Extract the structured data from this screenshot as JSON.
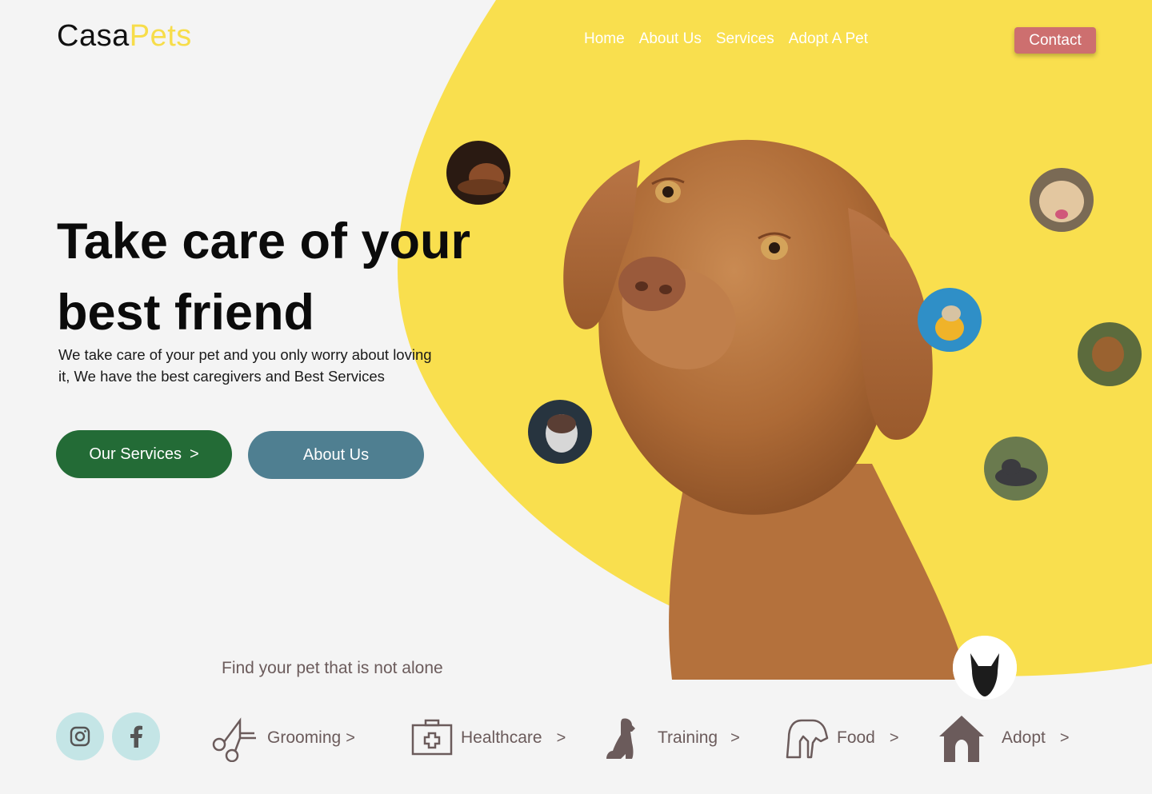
{
  "brand": {
    "part1": "Casa",
    "part2": "Pets"
  },
  "nav": {
    "items": [
      "Home",
      "About Us",
      "Services",
      "Adopt A Pet"
    ]
  },
  "contact_label": "Contact",
  "hero": {
    "title_line1": "Take care of your",
    "title_line2": "best friend",
    "description": "We take care of your pet and you only worry about loving it, We have the best caregivers and Best Services",
    "services_btn": "Our Services",
    "about_btn": "About Us",
    "chevron": ">"
  },
  "tagline": "Find your pet that is not alone",
  "categories": [
    {
      "label": "Grooming",
      "icon": "scissors-icon"
    },
    {
      "label": "Healthcare",
      "icon": "medical-kit-icon"
    },
    {
      "label": "Training",
      "icon": "sitting-dog-icon"
    },
    {
      "label": "Food",
      "icon": "dog-head-icon"
    },
    {
      "label": "Adopt",
      "icon": "house-icon"
    }
  ],
  "social": [
    "instagram-icon",
    "facebook-icon"
  ],
  "colors": {
    "accent_yellow": "#f9df4e",
    "services_green": "#236b36",
    "about_teal": "#4f7f91",
    "contact_red": "#cd6f6f",
    "social_bg": "#c4e5e6",
    "muted_text": "#6b5b5b"
  }
}
